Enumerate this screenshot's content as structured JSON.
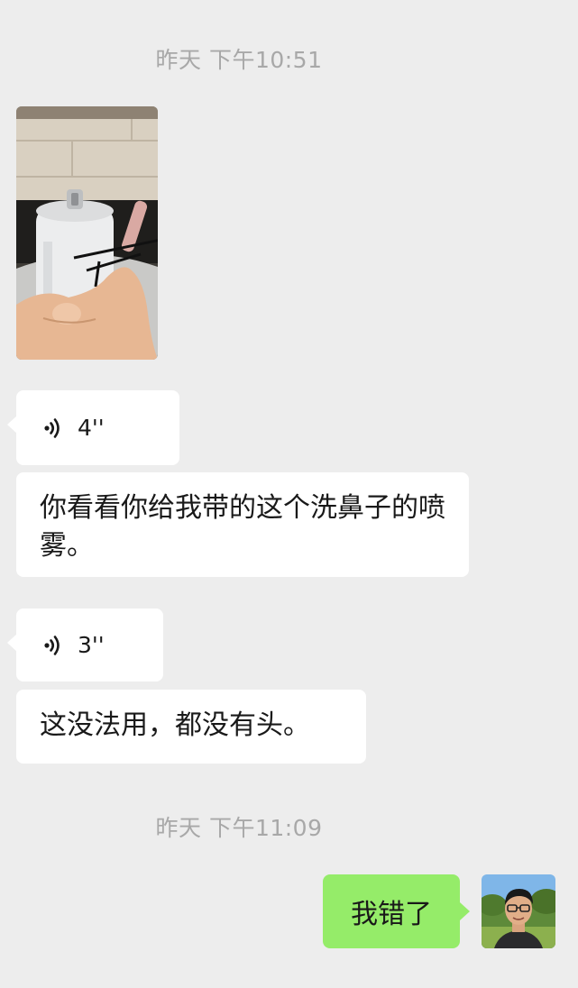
{
  "chat": {
    "timestamp_1": "昨天 下午10:51",
    "timestamp_2": "昨天 下午11:09",
    "messages": {
      "voice_1_duration": "4''",
      "text_1": "你看看你给我带的这个洗鼻子的喷雾。",
      "voice_2_duration": "3''",
      "text_2": "这没法用，都没有头。",
      "sent_1": "我错了"
    }
  },
  "icons": {
    "voice": "voice-wave-icon"
  },
  "colors": {
    "background": "#EDEDED",
    "received_bubble": "#FFFFFF",
    "sent_bubble": "#95EC69",
    "timestamp_text": "#A8A8A8",
    "message_text": "#191919"
  }
}
